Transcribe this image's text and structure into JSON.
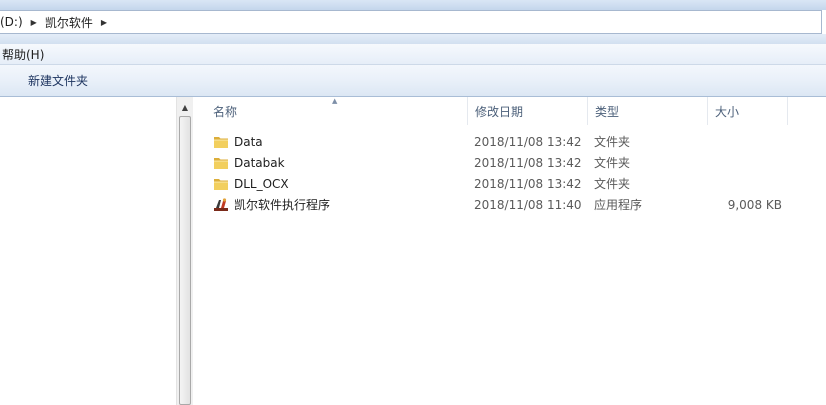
{
  "address": {
    "crumbs": [
      "(D:)",
      "凯尔软件"
    ]
  },
  "menu": {
    "help": "帮助(H)"
  },
  "toolbar": {
    "new_folder": "新建文件夹"
  },
  "columns": {
    "name": "名称",
    "date": "修改日期",
    "type": "类型",
    "size": "大小"
  },
  "files": [
    {
      "name": "Data",
      "date": "2018/11/08 13:42",
      "type": "文件夹",
      "size": "",
      "icon": "folder-icon"
    },
    {
      "name": "Databak",
      "date": "2018/11/08 13:42",
      "type": "文件夹",
      "size": "",
      "icon": "folder-icon"
    },
    {
      "name": "DLL_OCX",
      "date": "2018/11/08 13:42",
      "type": "文件夹",
      "size": "",
      "icon": "folder-icon"
    },
    {
      "name": "凯尔软件执行程序",
      "date": "2018/11/08 11:40",
      "type": "应用程序",
      "size": "9,008 KB",
      "icon": "application-icon"
    }
  ],
  "colors": {
    "header_text": "#4c607a",
    "toolbar_text": "#1e3560",
    "folder": "#e8c252"
  }
}
